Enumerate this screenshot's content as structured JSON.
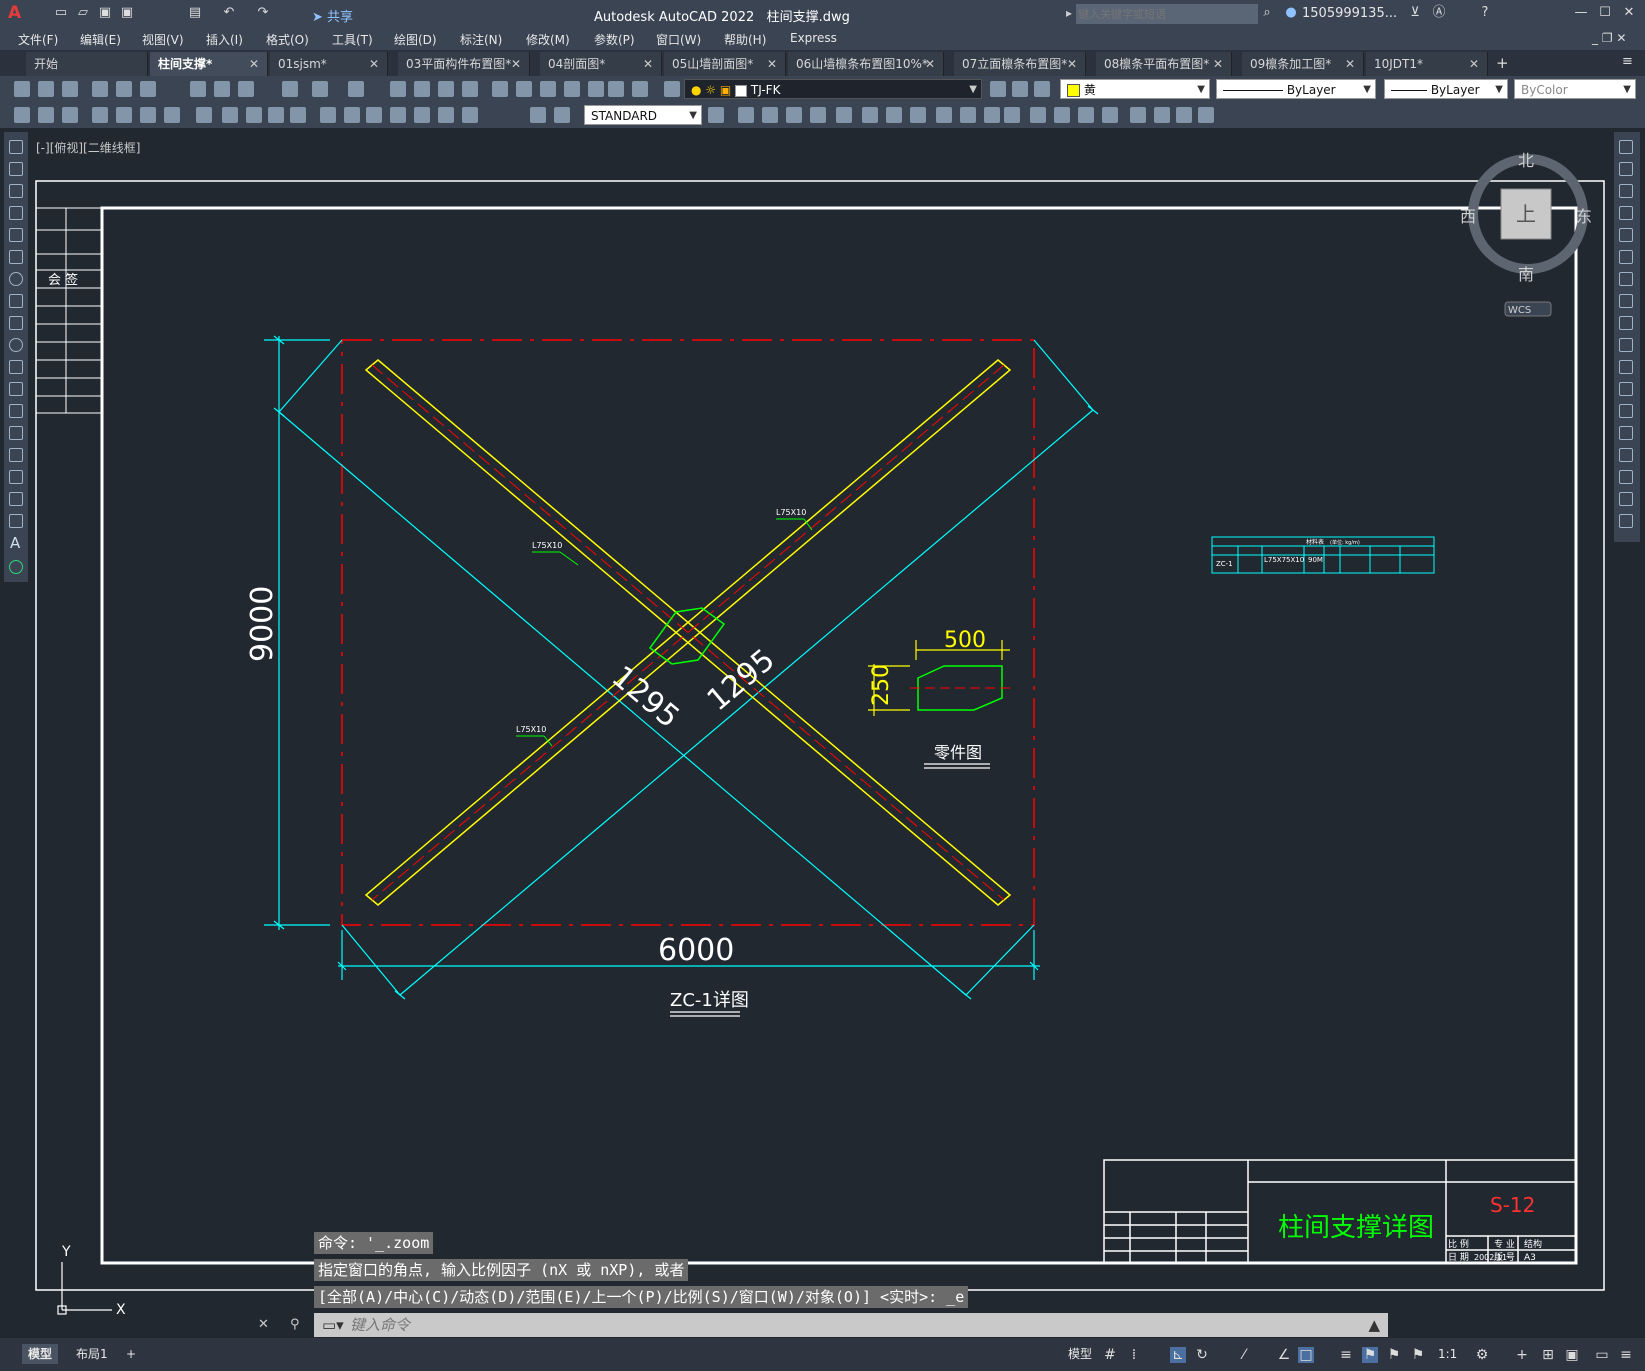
{
  "app": {
    "title": "Autodesk AutoCAD 2022",
    "filename": "柱间支撑.dwg",
    "search_placeholder": "键入关键字或短语",
    "user": "1505999135...",
    "share": "共享"
  },
  "menu": [
    "文件(F)",
    "编辑(E)",
    "视图(V)",
    "插入(I)",
    "格式(O)",
    "工具(T)",
    "绘图(D)",
    "标注(N)",
    "修改(M)",
    "参数(P)",
    "窗口(W)",
    "帮助(H)",
    "Express"
  ],
  "tabs": [
    {
      "label": "开始"
    },
    {
      "label": "柱间支撑*"
    },
    {
      "label": "01sjsm*"
    },
    {
      "label": "03平面构件布置图*"
    },
    {
      "label": "04剖面图*"
    },
    {
      "label": "05山墙剖面图*"
    },
    {
      "label": "06山墙檩条布置图10%*"
    },
    {
      "label": "07立面檩条布置图*"
    },
    {
      "label": "08檩条平面布置图*"
    },
    {
      "label": "09檩条加工图*"
    },
    {
      "label": "10JDT1*"
    }
  ],
  "toolbar": {
    "layer": "TJ-FK",
    "color": "黄",
    "linetype": "ByLayer",
    "lineweight": "ByLayer",
    "plotstyle": "ByColor",
    "textstyle": "STANDARD"
  },
  "viewport_label": "[-][俯视][二维线框]",
  "viewcube": {
    "north": "北",
    "south": "南",
    "east": "东",
    "west": "西",
    "top": "上",
    "wcs": "WCS"
  },
  "drawing": {
    "left_table_label": "会 签",
    "dim_height": "9000",
    "dim_width": "6000",
    "dim_diag1": "1295",
    "dim_diag2": "1295",
    "member_label": "L75X10",
    "member_label_2": "L75X10",
    "member_label_3": "L75X10",
    "part_dim_w": "500",
    "part_dim_h": "250",
    "part_title": "零件图",
    "detail_title": "ZC-1详图",
    "mat_table": {
      "title": "材料表",
      "unit": "(单位: kg/m)",
      "row_id": "ZC-1",
      "row_spec": "L75X75X10",
      "row_len": "90M"
    },
    "title_block": {
      "drawing_name": "柱间支撑详图",
      "number": "S-12",
      "scale_label": "比 例",
      "date_label": "日 期",
      "date": "2002.11",
      "major_label": "专 业",
      "major": "结构",
      "sheet_label": "版 号",
      "sheet": "A3"
    }
  },
  "command": {
    "history": [
      "命令: '_.zoom",
      "指定窗口的角点, 输入比例因子 (nX 或 nXP), 或者",
      "[全部(A)/中心(C)/动态(D)/范围(E)/上一个(P)/比例(S)/窗口(W)/对象(O)] <实时>: _e"
    ],
    "placeholder": "键入命令"
  },
  "status": {
    "model_tab": "模型",
    "layout_tab": "布局1",
    "model_btn": "模型",
    "scale": "1:1"
  },
  "colors": {
    "bg": "#212830",
    "ui": "#3b4453",
    "yellow": "#ffff00",
    "cyan": "#00ffff",
    "red": "#ff0000",
    "green": "#00ff00",
    "white": "#ffffff"
  }
}
